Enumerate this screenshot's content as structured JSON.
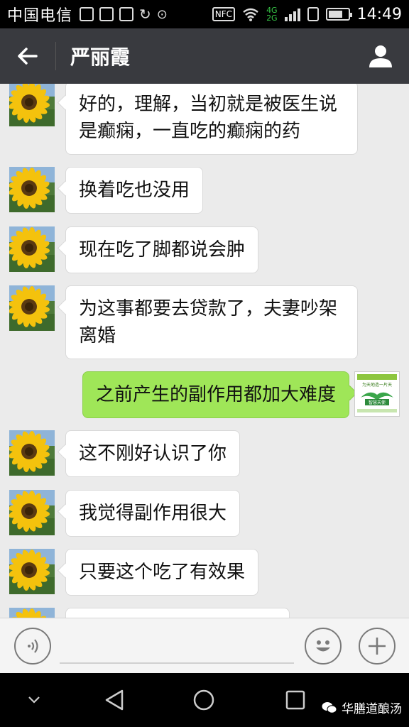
{
  "status_bar": {
    "carrier": "中国电信",
    "nfc": "NFC",
    "net_top": "4G",
    "net_bottom": "2G",
    "time": "14:49",
    "battery_level": 0.75
  },
  "header": {
    "title": "严丽霞"
  },
  "messages": [
    {
      "side": "left",
      "text": "好的，理解，当初就是被医生说是癫痫，一直吃的癫痫的药"
    },
    {
      "side": "left",
      "text": "换着吃也没用"
    },
    {
      "side": "left",
      "text": "现在吃了脚都说会肿"
    },
    {
      "side": "left",
      "text": "为这事都要去贷款了，夫妻吵架离婚"
    },
    {
      "side": "right",
      "text": "之前产生的副作用都加大难度"
    },
    {
      "side": "left",
      "text": "这不刚好认识了你"
    },
    {
      "side": "left",
      "text": "我觉得副作用很大"
    },
    {
      "side": "left",
      "text": "只要这个吃了有效果"
    }
  ],
  "my_avatar_text": {
    "line1": "为天地造一片天",
    "badge": "智慧天使"
  },
  "watermark": "华膳道酿汤",
  "colors": {
    "navbar": "#393a3f",
    "bubble_mine": "#9fe658",
    "bubble_theirs": "#ffffff",
    "chat_bg": "#ebebeb"
  }
}
